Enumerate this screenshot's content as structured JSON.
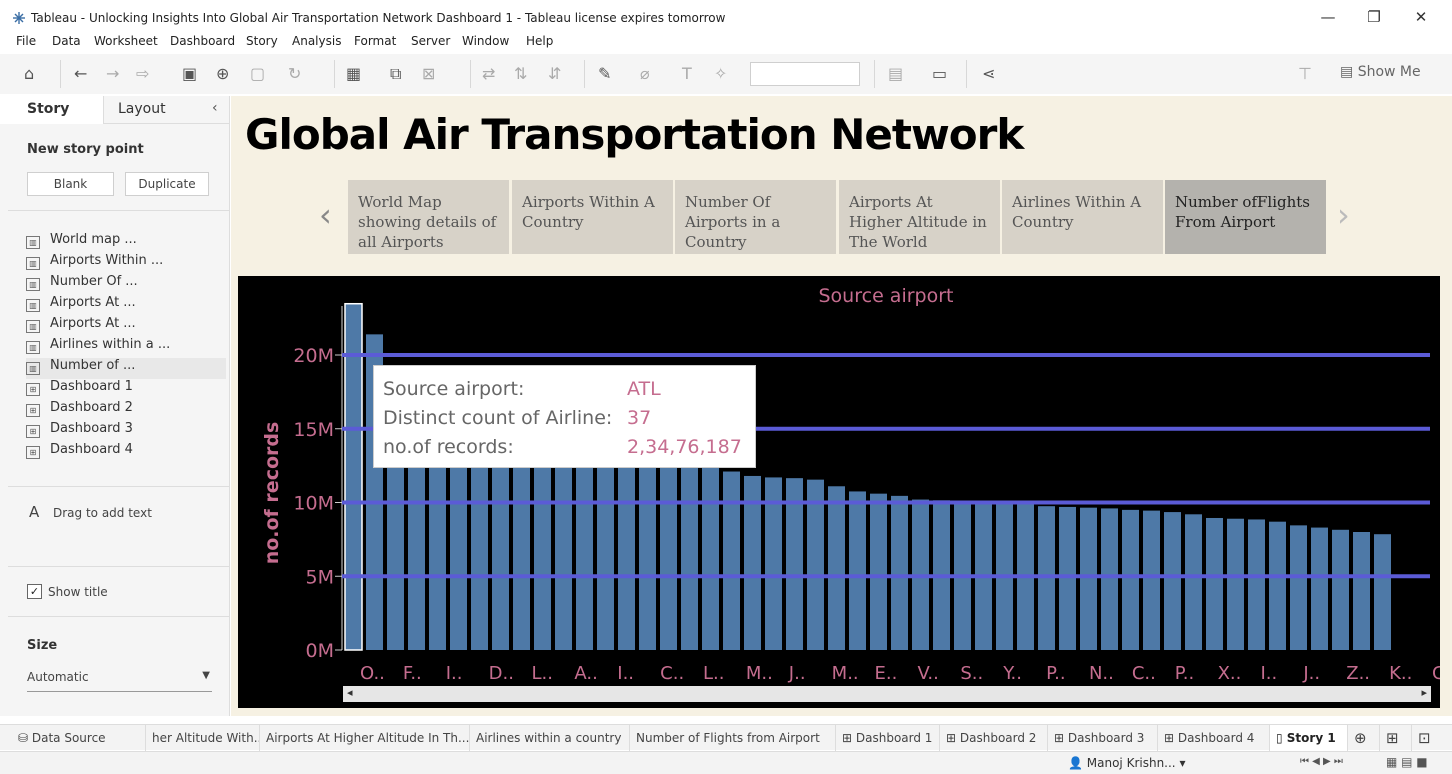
{
  "window": {
    "title": "Tableau - Unlocking Insights Into Global Air Transportation Network Dashboard 1 - Tableau license expires tomorrow",
    "minimize": "—",
    "restore": "❐",
    "close": "✕"
  },
  "menu": [
    "File",
    "Data",
    "Worksheet",
    "Dashboard",
    "Story",
    "Analysis",
    "Format",
    "Server",
    "Window",
    "Help"
  ],
  "toolbar": {
    "show_me": "Show Me"
  },
  "side_panel": {
    "tabs": [
      "Story",
      "Layout"
    ],
    "new_story_point": "New story point",
    "blank": "Blank",
    "duplicate": "Duplicate",
    "sheets": [
      "World map ...",
      "Airports Within ...",
      "Number Of ...",
      "Airports At ...",
      "Airports At ...",
      "Airlines within a ...",
      "Number of ...",
      "Dashboard 1",
      "Dashboard 2",
      "Dashboard 3",
      "Dashboard 4"
    ],
    "drag_text": "Drag to add text",
    "show_title": "Show title",
    "size_label": "Size",
    "size_value": "Automatic"
  },
  "story": {
    "title": "Global Air Transportation Network",
    "points": [
      "World Map showing details of all Airports",
      "Airports Within A Country",
      "Number Of Airports in a Country",
      "Airports At Higher Altitude in The World",
      "Airlines Within A Country",
      "Number ofFlights From Airport"
    ]
  },
  "tooltip": {
    "rows": [
      {
        "label": "Source airport:",
        "value": "ATL"
      },
      {
        "label": "Distinct count of Airline:",
        "value": "37"
      },
      {
        "label": "no.of records:",
        "value": "2,34,76,187"
      }
    ]
  },
  "colors": {
    "bar": "#4e79a7",
    "reference_line": "#5b5bd6",
    "axis_text": "#c56d8f",
    "chart_bg": "#000000"
  },
  "chart_data": {
    "type": "bar",
    "title": "Source airport",
    "ylabel": "no.of records",
    "yticks": [
      "0M",
      "5M",
      "10M",
      "15M",
      "20M"
    ],
    "ylim": [
      0,
      24000000
    ],
    "x_tick_labels": [
      "O..",
      "F..",
      "I..",
      "D..",
      "L..",
      "A..",
      "I..",
      "C..",
      "L..",
      "M..",
      "J..",
      "M..",
      "E..",
      "V..",
      "S..",
      "Y..",
      "P..",
      "N..",
      "C..",
      "P..",
      "X..",
      "I..",
      "J..",
      "Z..",
      "K..",
      "C"
    ],
    "reference_lines": [
      5000000,
      10000000,
      15000000,
      20000000
    ],
    "values": [
      23476187,
      21400000,
      17500000,
      16500000,
      15800000,
      15200000,
      14800000,
      14500000,
      14200000,
      13900000,
      13600000,
      13400000,
      13200000,
      13000000,
      12900000,
      12850000,
      12800000,
      12500000,
      12100000,
      11800000,
      11700000,
      11650000,
      11550000,
      11100000,
      10750000,
      10600000,
      10450000,
      10200000,
      10150000,
      10100000,
      10050000,
      10000000,
      9950000,
      9750000,
      9700000,
      9650000,
      9600000,
      9500000,
      9450000,
      9350000,
      9200000,
      8950000,
      8900000,
      8850000,
      8700000,
      8450000,
      8300000,
      8150000,
      8000000,
      7850000
    ],
    "highlighted_index": 0
  },
  "bottom_tabs": [
    "Data Source",
    "her Altitude With...",
    "Airports At Higher Altitude In Th...",
    "Airlines within a country",
    "Number of  Flights from Airport",
    "Dashboard 1",
    "Dashboard 2",
    "Dashboard 3",
    "Dashboard 4",
    "Story 1"
  ],
  "status": {
    "user": "Manoj Krishn..."
  }
}
